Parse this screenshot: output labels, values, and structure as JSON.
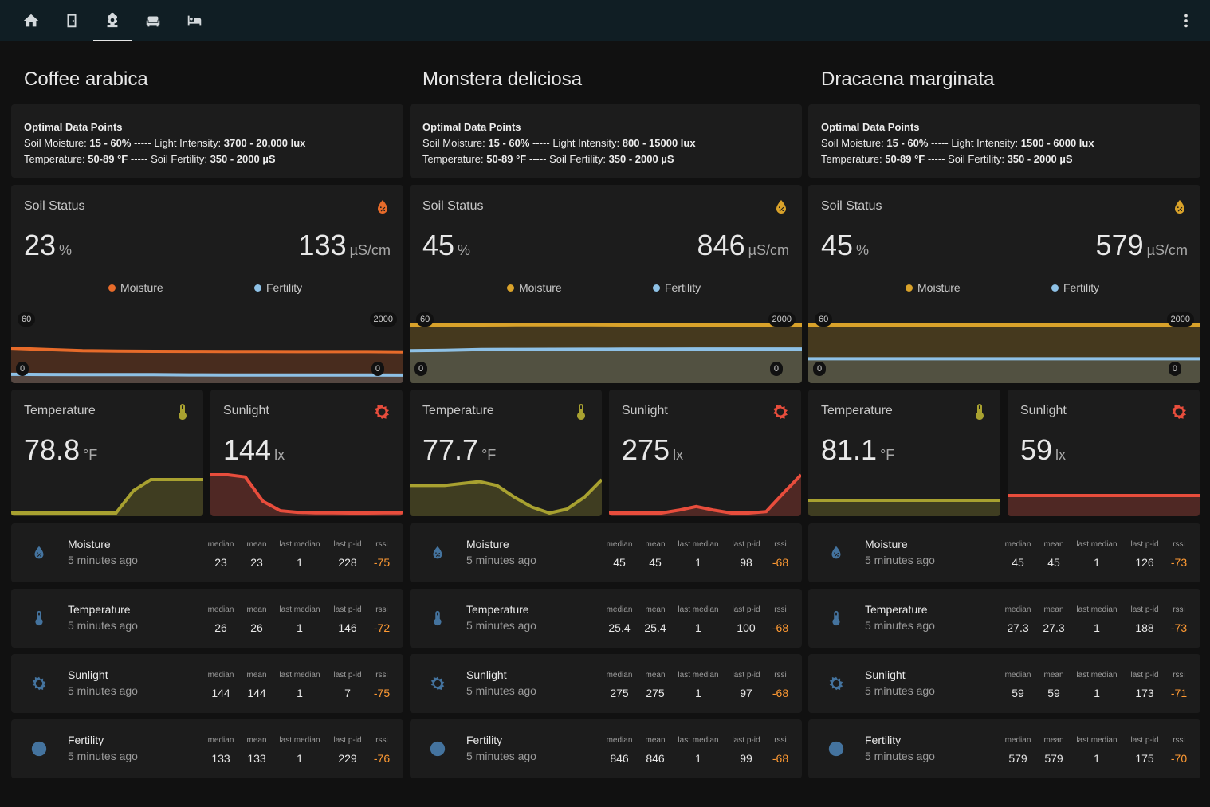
{
  "colors": {
    "moisture_low": "#e76b2a",
    "moisture_mid": "#d9a22a",
    "fertility": "#8ec1e6",
    "temperature": "#a8a130",
    "sunlight": "#e84d3c",
    "rssi": "#ff9a33",
    "entity_icon": "#44739e",
    "topbar_bg": "#101e24"
  },
  "topbar": {
    "tabs": [
      {
        "icon": "home-icon"
      },
      {
        "icon": "door-icon"
      },
      {
        "icon": "flower-icon",
        "active": true
      },
      {
        "icon": "sofa-icon"
      },
      {
        "icon": "bed-icon"
      }
    ],
    "menu_icon": "more-vertical-icon"
  },
  "labels": {
    "optimal_header": "Optimal Data Points",
    "soil_moisture": "Soil Moisture:",
    "light_intensity": "Light Intensity:",
    "temperature_label": "Temperature:",
    "soil_fertility": "Soil Fertility:",
    "sep": "-----",
    "soil_status": "Soil Status",
    "moisture": "Moisture",
    "fertility": "Fertility",
    "temperature": "Temperature",
    "sunlight": "Sunlight",
    "pct_unit": "%",
    "ec_unit": "µS/cm",
    "temp_unit": "°F",
    "lux_unit": "lx",
    "axis_left_max": "60",
    "axis_right_max": "2000",
    "axis_min": "0",
    "attr_median": "median",
    "attr_mean": "mean",
    "attr_last_median": "last median",
    "attr_last_pid": "last p-id",
    "attr_rssi": "rssi",
    "ago": "5 minutes ago"
  },
  "plants": [
    {
      "name": "Coffee arabica",
      "optimal": {
        "moisture": "15 - 60%",
        "light": "3700 - 20,000 lux",
        "temperature": "50-89 °F",
        "fertility": "350 - 2000 µS"
      },
      "soil": {
        "moisture": "23",
        "fertility": "133",
        "moisture_color": "#e76b2a"
      },
      "temperature": "78.8",
      "sunlight": "144",
      "history": {
        "moisture": [
          26,
          25,
          24,
          23.7,
          23.5,
          23.4,
          23.3,
          23.3,
          23.2,
          23.2,
          23.2,
          23
        ],
        "fertility": [
          155,
          150,
          148,
          148,
          146,
          140,
          136,
          135,
          135,
          134,
          134,
          133
        ],
        "temperature": [
          73,
          73,
          73,
          73,
          73,
          73,
          73,
          77,
          79,
          79,
          79,
          79
        ],
        "sunlight": [
          400,
          400,
          380,
          150,
          60,
          45,
          40,
          40,
          38,
          38,
          40,
          40
        ]
      },
      "sensors": [
        {
          "name": "Moisture",
          "icon": "water-percent-icon",
          "median": "23",
          "mean": "23",
          "last_median": "1",
          "last_pid": "228",
          "rssi": "-75"
        },
        {
          "name": "Temperature",
          "icon": "thermometer-icon",
          "median": "26",
          "mean": "26",
          "last_median": "1",
          "last_pid": "146",
          "rssi": "-72"
        },
        {
          "name": "Sunlight",
          "icon": "white-balance-sunny-icon",
          "median": "144",
          "mean": "144",
          "last_median": "1",
          "last_pid": "7",
          "rssi": "-75"
        },
        {
          "name": "Fertility",
          "icon": "flash-circle-icon",
          "median": "133",
          "mean": "133",
          "last_median": "1",
          "last_pid": "229",
          "rssi": "-76"
        }
      ]
    },
    {
      "name": "Monstera deliciosa",
      "optimal": {
        "moisture": "15 - 60%",
        "light": "800 - 15000 lux",
        "temperature": "50-89 °F",
        "fertility": "350 - 2000 µS"
      },
      "soil": {
        "moisture": "45",
        "fertility": "846",
        "moisture_color": "#d9a22a"
      },
      "temperature": "77.7",
      "sunlight": "275",
      "history": {
        "moisture": [
          45,
          45,
          45,
          45.1,
          45.2,
          45.1,
          45,
          45,
          45,
          45,
          45,
          45
        ],
        "fertility": [
          800,
          810,
          830,
          835,
          838,
          840,
          842,
          844,
          845,
          846,
          846,
          846
        ],
        "temperature": [
          77.4,
          77.4,
          77.4,
          77.5,
          77.6,
          77.4,
          76.8,
          76.3,
          76,
          76.2,
          76.8,
          77.7
        ],
        "sunlight": [
          10,
          10,
          10,
          10,
          30,
          55,
          30,
          10,
          10,
          20,
          150,
          275
        ]
      },
      "sensors": [
        {
          "name": "Moisture",
          "icon": "water-percent-icon",
          "median": "45",
          "mean": "45",
          "last_median": "1",
          "last_pid": "98",
          "rssi": "-68"
        },
        {
          "name": "Temperature",
          "icon": "thermometer-icon",
          "median": "25.4",
          "mean": "25.4",
          "last_median": "1",
          "last_pid": "100",
          "rssi": "-68"
        },
        {
          "name": "Sunlight",
          "icon": "white-balance-sunny-icon",
          "median": "275",
          "mean": "275",
          "last_median": "1",
          "last_pid": "97",
          "rssi": "-68"
        },
        {
          "name": "Fertility",
          "icon": "flash-circle-icon",
          "median": "846",
          "mean": "846",
          "last_median": "1",
          "last_pid": "99",
          "rssi": "-68"
        }
      ]
    },
    {
      "name": "Dracaena marginata",
      "optimal": {
        "moisture": "15 - 60%",
        "light": "1500 - 6000 lux",
        "temperature": "50-89 °F",
        "fertility": "350 - 2000 µS"
      },
      "soil": {
        "moisture": "45",
        "fertility": "579",
        "moisture_color": "#d9a22a"
      },
      "temperature": "81.1",
      "sunlight": "59",
      "history": {
        "moisture": [
          45,
          45,
          45,
          45,
          45,
          45,
          45,
          45,
          45,
          45,
          45,
          45
        ],
        "fertility": [
          579,
          579,
          579,
          579,
          579,
          579,
          579,
          579,
          579,
          579,
          579,
          579
        ],
        "temperature": [
          81.1,
          81.1,
          81.1,
          81.1,
          81.1,
          81.1,
          81.1,
          81.1,
          81.1,
          81.1,
          81.1,
          81.1
        ],
        "sunlight": [
          59,
          59,
          59,
          59,
          59,
          59,
          59,
          59,
          59,
          59,
          59,
          59
        ]
      },
      "sensors": [
        {
          "name": "Moisture",
          "icon": "water-percent-icon",
          "median": "45",
          "mean": "45",
          "last_median": "1",
          "last_pid": "126",
          "rssi": "-73"
        },
        {
          "name": "Temperature",
          "icon": "thermometer-icon",
          "median": "27.3",
          "mean": "27.3",
          "last_median": "1",
          "last_pid": "188",
          "rssi": "-73"
        },
        {
          "name": "Sunlight",
          "icon": "white-balance-sunny-icon",
          "median": "59",
          "mean": "59",
          "last_median": "1",
          "last_pid": "173",
          "rssi": "-71"
        },
        {
          "name": "Fertility",
          "icon": "flash-circle-icon",
          "median": "579",
          "mean": "579",
          "last_median": "1",
          "last_pid": "175",
          "rssi": "-70"
        }
      ]
    }
  ]
}
